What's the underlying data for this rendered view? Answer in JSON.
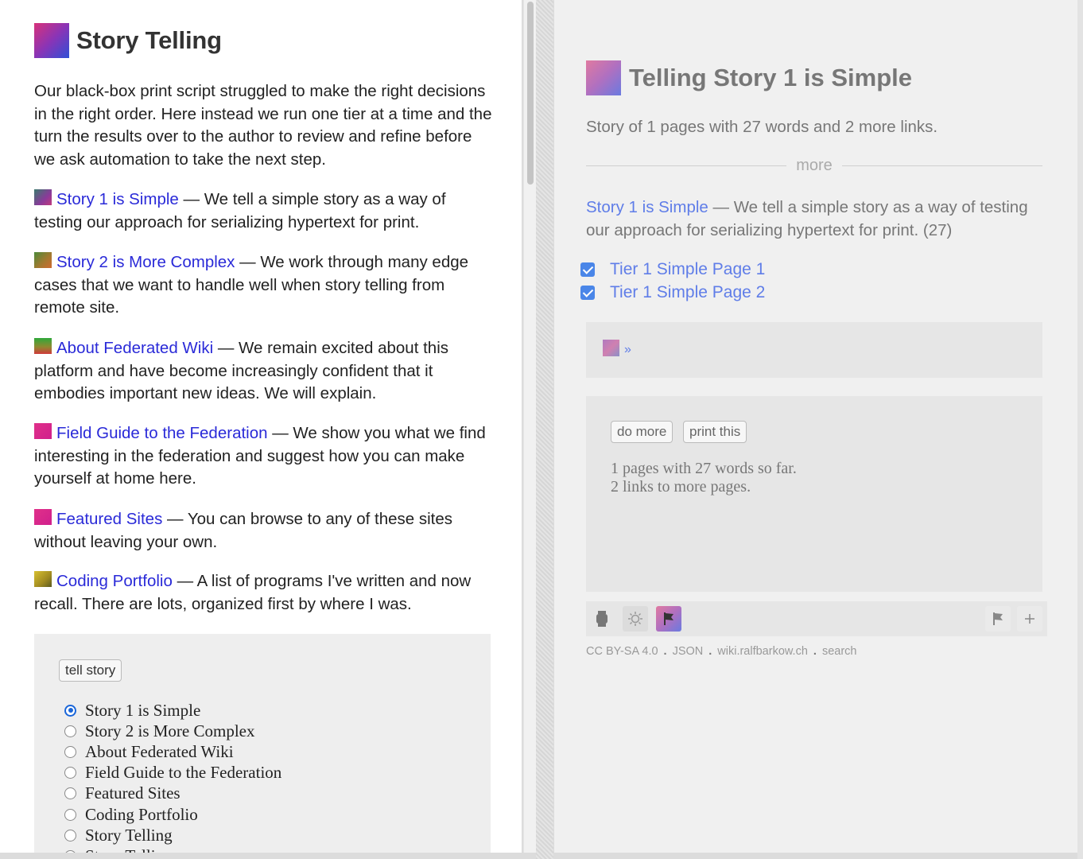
{
  "left": {
    "title": "Story Telling",
    "intro": "Our black-box print script struggled to make the right decisions in the right order. Here instead we run one tier at a time and the turn the results over to the author to review and refine before we ask automation to take the next step.",
    "links": [
      {
        "title": "Story 1 is Simple",
        "text": " — We tell a simple story as a way of testing our approach for serializing hypertext for print."
      },
      {
        "title": "Story 2 is More Complex",
        "text": " — We work through many edge cases that we want to handle well when story telling from remote site."
      },
      {
        "title": "About Federated Wiki",
        "text": " — We remain excited about this platform and have become increasingly confident that it embodies important new ideas. We will explain."
      },
      {
        "title": "Field Guide to the Federation",
        "text": " — We show you what we find interesting in the federation and suggest how you can make yourself at home here."
      },
      {
        "title": "Featured Sites",
        "text": " — You can browse to any of these sites without leaving your own."
      },
      {
        "title": "Coding Portfolio",
        "text": " — A list of programs I've written and now recall. There are lots, organized first by where I was."
      }
    ],
    "tell_button": "tell story",
    "radios": [
      {
        "label": "Story 1 is Simple",
        "selected": true
      },
      {
        "label": "Story 2 is More Complex",
        "selected": false
      },
      {
        "label": "About Federated Wiki",
        "selected": false
      },
      {
        "label": "Field Guide to the Federation",
        "selected": false
      },
      {
        "label": "Featured Sites",
        "selected": false
      },
      {
        "label": "Coding Portfolio",
        "selected": false
      },
      {
        "label": "Story Telling",
        "selected": false
      },
      {
        "label": "Story Telling",
        "selected": false
      }
    ]
  },
  "right": {
    "title": "Telling Story 1 is Simple",
    "summary": "Story of 1 pages with 27 words and 2 more links.",
    "more_label": "more",
    "para_link": "Story 1 is Simple",
    "para_text": " — We tell a simple story as a way of testing our approach for serializing hypertext for print. (27)",
    "checks": [
      "Tier 1 Simple Page 1",
      "Tier 1 Simple Page 2"
    ],
    "ref_link": "»",
    "do_more": "do more",
    "print_this": "print this",
    "status_line1": "1 pages with 27 words so far.",
    "status_line2": "2 links to more pages.",
    "license": "CC BY-SA 4.0",
    "json": "JSON",
    "site": "wiki.ralfbarkow.ch",
    "search": "search"
  }
}
